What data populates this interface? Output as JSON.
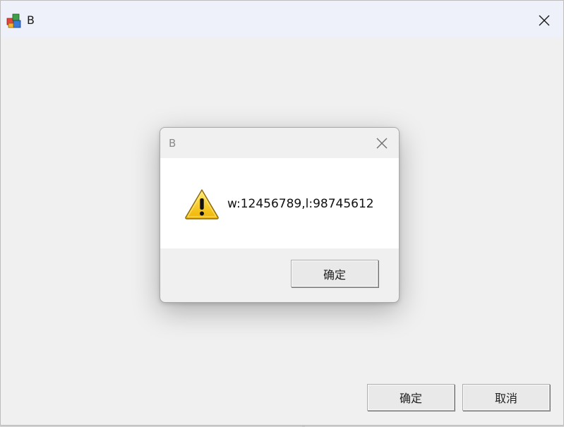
{
  "main_window": {
    "title": "B",
    "app_icon": "colored-blocks-icon",
    "close_icon": "close-icon",
    "ok_label": "确定",
    "cancel_label": "取消"
  },
  "dialog": {
    "title": "B",
    "close_icon": "close-icon",
    "warning_icon": "warning-icon",
    "message": "w:12456789,l:98745612",
    "ok_label": "确定"
  },
  "colors": {
    "titlebar_bg": "#eef1fa",
    "window_bg": "#f0f0f0",
    "dialog_body_bg": "#ffffff",
    "warning_yellow": "#f5c400"
  }
}
